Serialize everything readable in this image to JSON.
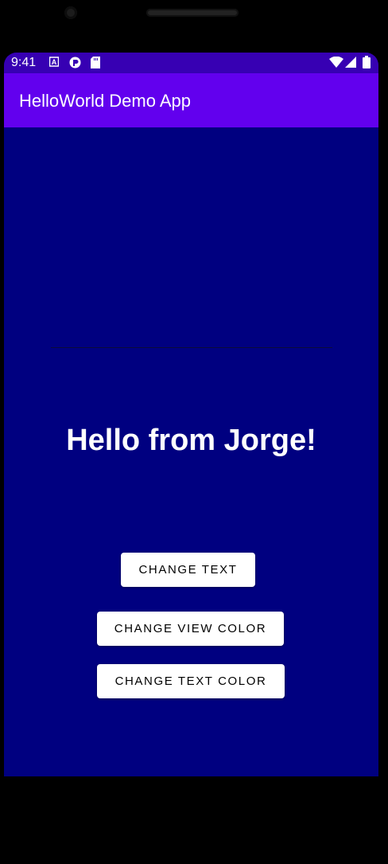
{
  "status_bar": {
    "time": "9:41",
    "left_icons": [
      "font-a-icon",
      "app-circle-icon",
      "sd-card-icon"
    ],
    "right_icons": [
      "wifi-icon",
      "cell-signal-icon",
      "battery-icon"
    ]
  },
  "app_bar": {
    "title": "HelloWorld Demo App"
  },
  "main": {
    "greeting": "Hello from Jorge!",
    "background_color": "#000080"
  },
  "buttons": {
    "change_text": "CHANGE TEXT",
    "change_view_color": "CHANGE VIEW COLOR",
    "change_text_color": "CHANGE TEXT COLOR"
  },
  "colors": {
    "status_bar": "#3700b3",
    "app_bar": "#6200ee",
    "button_bg": "#ffffff"
  }
}
